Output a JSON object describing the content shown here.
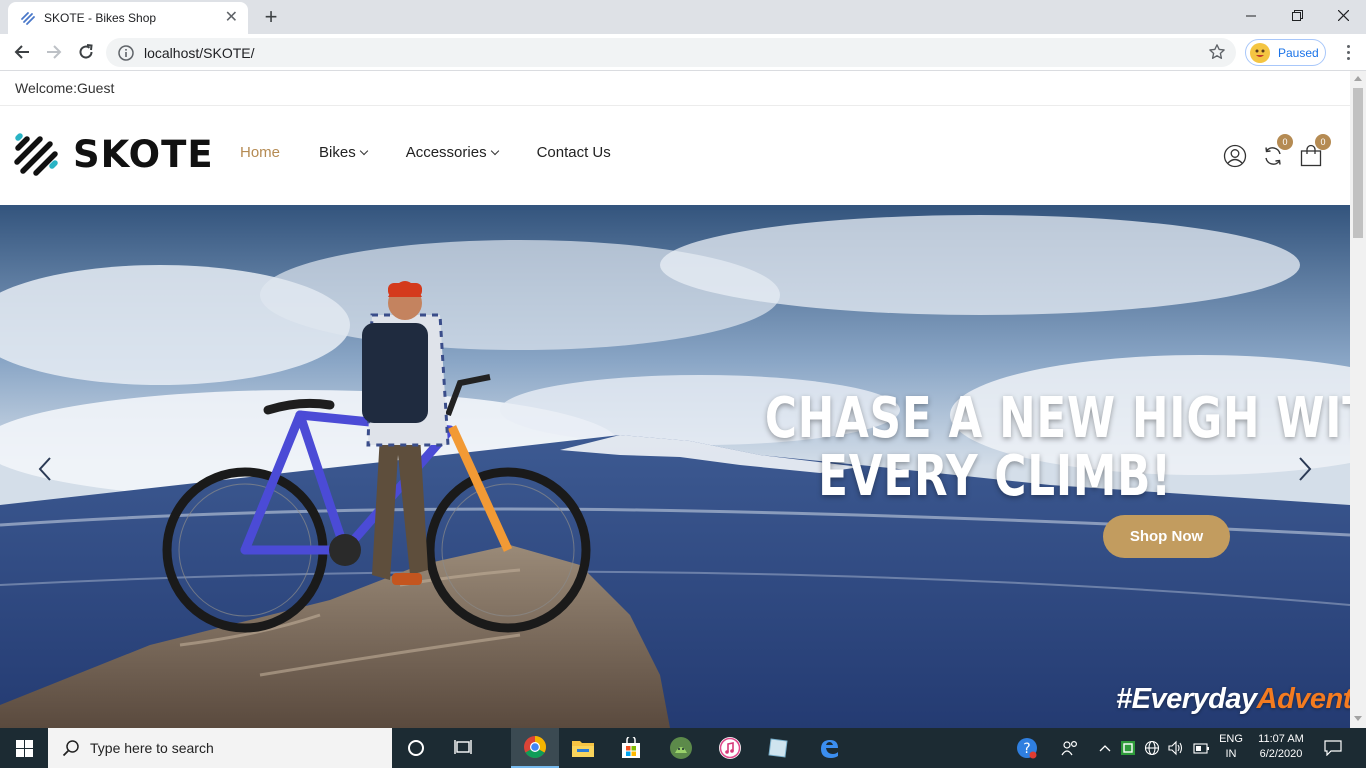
{
  "browser": {
    "tab_title": "SKOTE - Bikes Shop",
    "url": "localhost/SKOTE/",
    "profile_label": "Paused"
  },
  "site": {
    "welcome": "Welcome:Guest",
    "brand": "SKOTE",
    "nav": [
      {
        "label": "Home",
        "active": true
      },
      {
        "label": "Bikes",
        "dropdown": true
      },
      {
        "label": "Accessories",
        "dropdown": true
      },
      {
        "label": "Contact Us"
      }
    ],
    "compare_count": "0",
    "cart_count": "0",
    "accent_color": "#b58b53"
  },
  "hero": {
    "headline_line1": "CHASE A NEW HIGH WITH",
    "headline_line2": "EVERY CLIMB!",
    "cta_label": "Shop Now",
    "hashtag_part1": "#Everyday",
    "hashtag_part2": "Adventure"
  },
  "taskbar": {
    "search_placeholder": "Type here to search",
    "lang_line1": "ENG",
    "lang_line2": "IN",
    "time": "11:07 AM",
    "date": "6/2/2020"
  }
}
